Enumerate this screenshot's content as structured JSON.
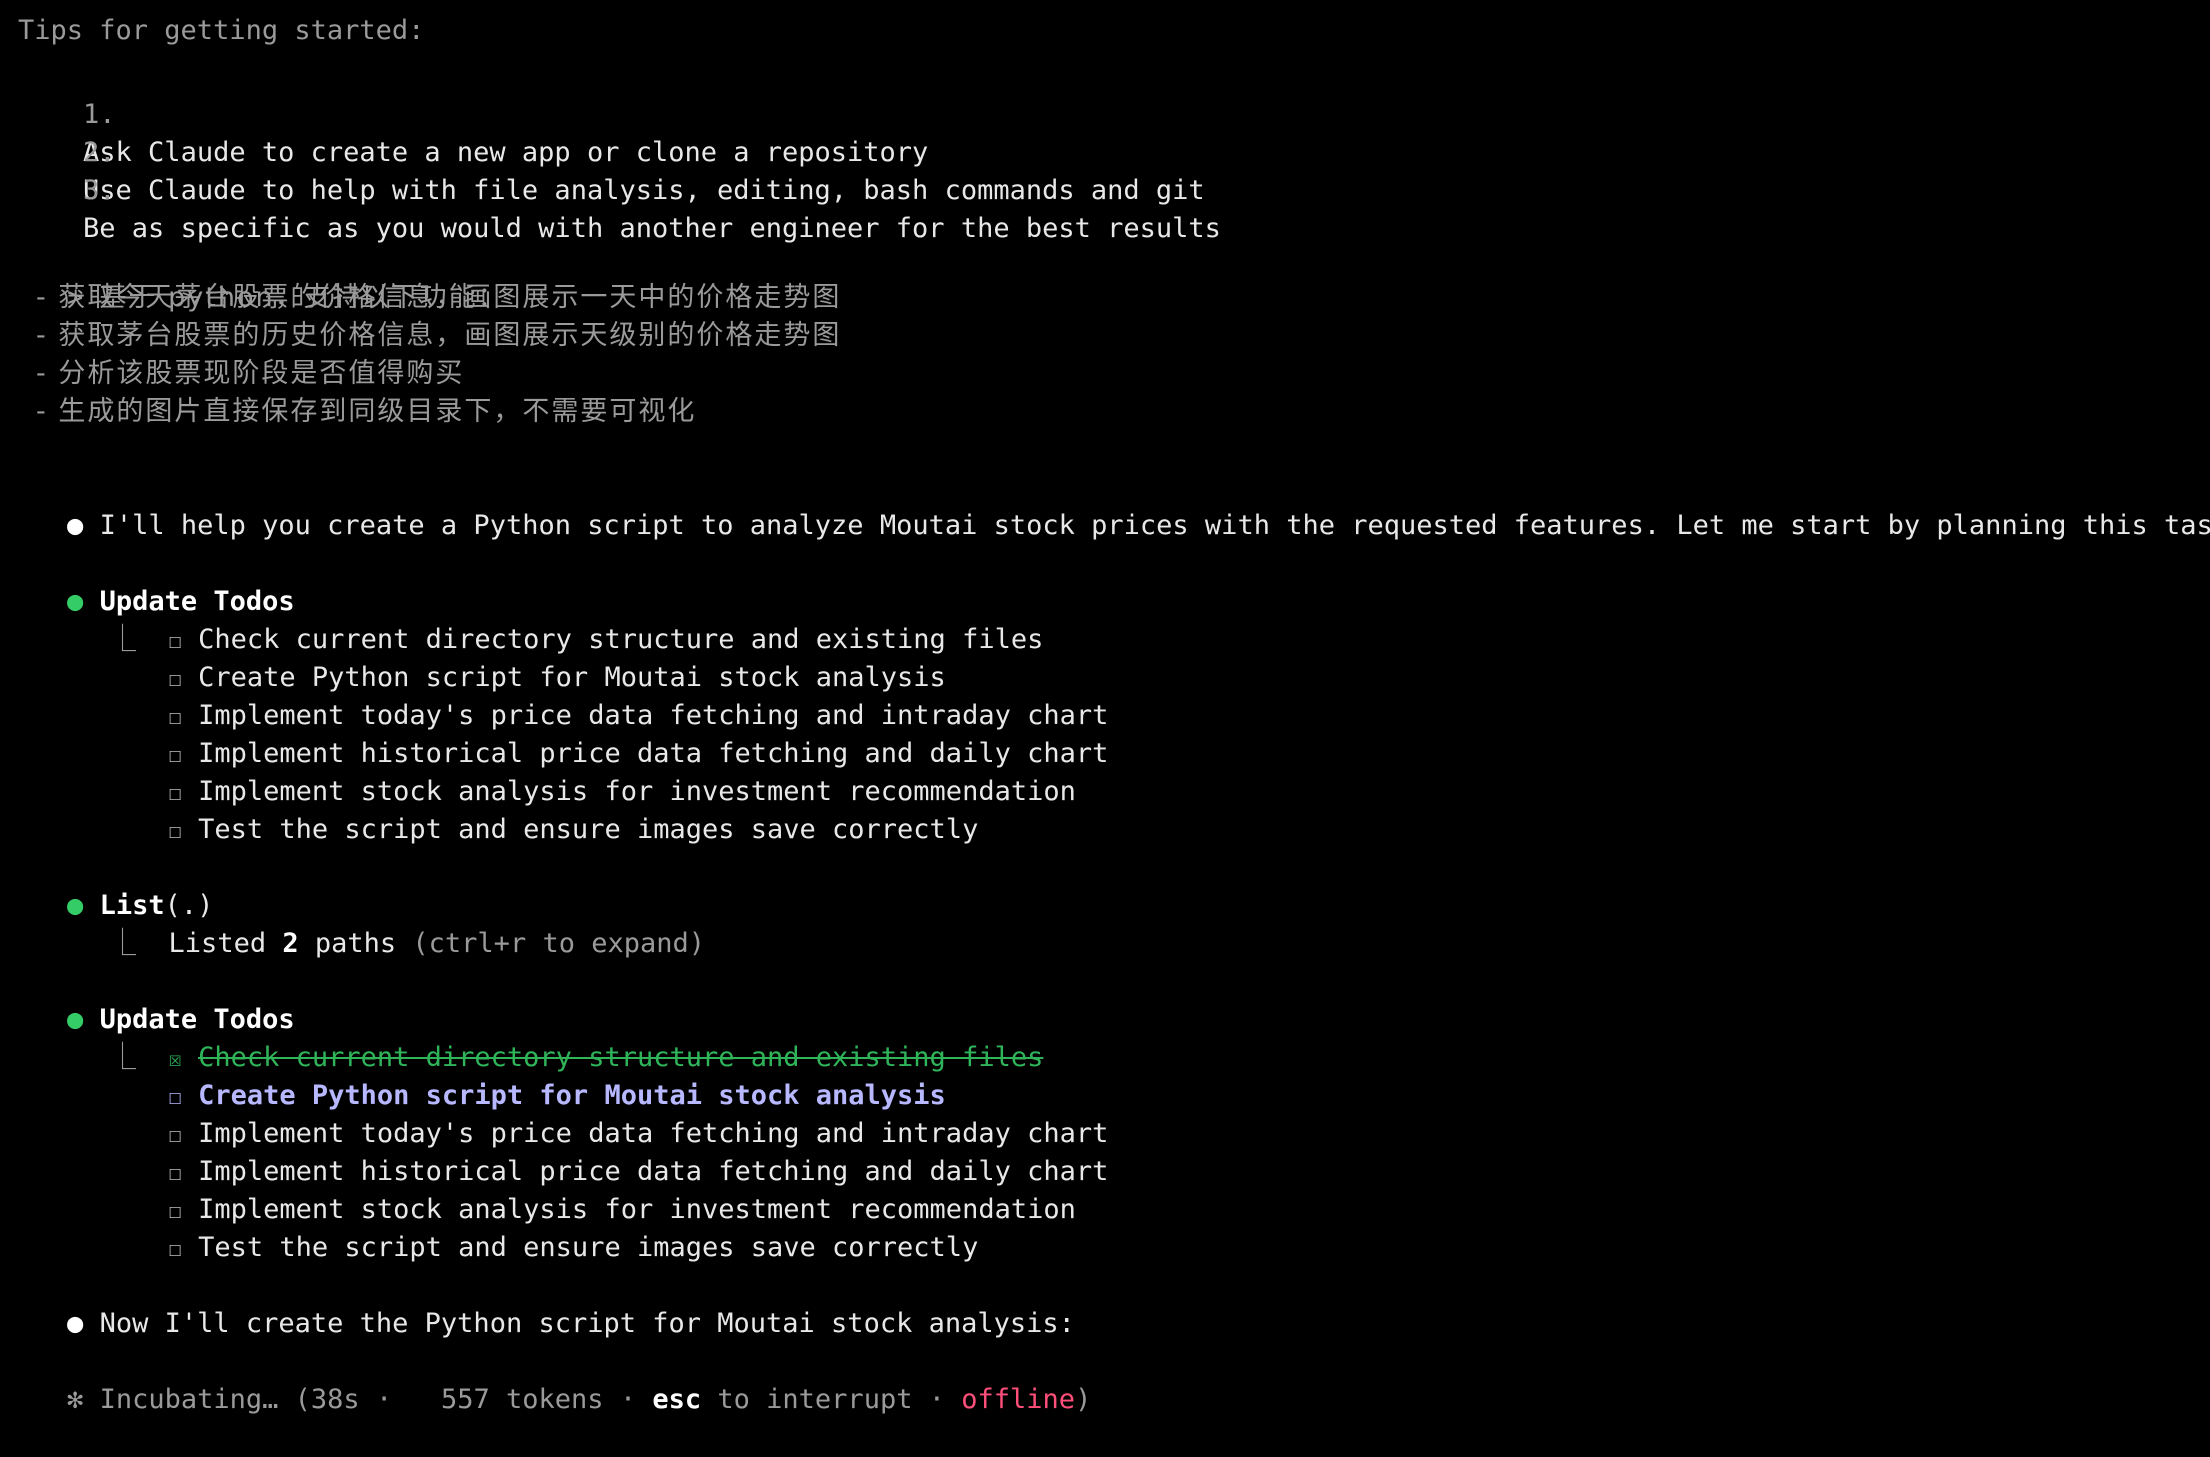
{
  "tips": {
    "heading": "Tips for getting started:",
    "items": [
      {
        "num": "1.",
        "text": "Ask Claude to create a new app or clone a repository"
      },
      {
        "num": "2.",
        "text": "Use Claude to help with file analysis, editing, bash commands and git"
      },
      {
        "num": "3.",
        "text": "Be as specific as you would with another engineer for the best results"
      }
    ]
  },
  "prompt": {
    "marker": ">",
    "lines": [
      "基于 python，支持以下功能：",
      "- 获取今天茅台股票的价格信息，画图展示一天中的价格走势图",
      "- 获取茅台股票的历史价格信息，画图展示天级别的价格走势图",
      "- 分析该股票现阶段是否值得购买",
      "- 生成的图片直接保存到同级目录下，不需要可视化"
    ]
  },
  "messages": {
    "intro": "I'll help you create a Python script to analyze Moutai stock prices with the requested features. Let me start by planning this task.",
    "now": "Now I'll create the Python script for Moutai stock analysis:"
  },
  "todos1": {
    "title": "Update Todos",
    "items": [
      "Check current directory structure and existing files",
      "Create Python script for Moutai stock analysis",
      "Implement today's price data fetching and intraday chart",
      "Implement historical price data fetching and daily chart",
      "Implement stock analysis for investment recommendation",
      "Test the script and ensure images save correctly"
    ]
  },
  "list_tool": {
    "name": "List",
    "arg": "(.)",
    "result_pre": "Listed ",
    "count": "2",
    "result_post": " paths ",
    "hint": "(ctrl+r to expand)"
  },
  "todos2": {
    "title": "Update Todos",
    "done": "Check current directory structure and existing files",
    "active": "Create Python script for Moutai stock analysis",
    "items": [
      "Implement today's price data fetching and intraday chart",
      "Implement historical price data fetching and daily chart",
      "Implement stock analysis for investment recommendation",
      "Test the script and ensure images save correctly"
    ]
  },
  "status": {
    "spinner": "✻",
    "label": "Incubating…",
    "time": "(38s",
    "sep1": "·",
    "tokens": "557 tokens",
    "sep2": "·",
    "esc": "esc",
    "interrupt": "to interrupt",
    "sep3": "·",
    "offline": "offline",
    "close": ")"
  },
  "colors": {
    "background": "#000000",
    "green_bullet": "#33cc66",
    "done_strike": "#2fb45a",
    "active_todo": "#b7b8ff",
    "offline": "#ff4f7a"
  }
}
